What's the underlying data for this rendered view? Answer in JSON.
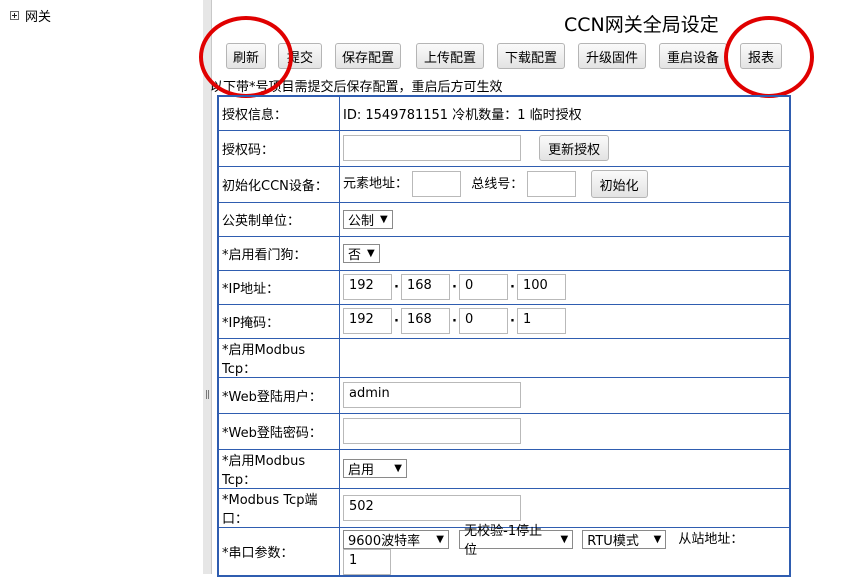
{
  "sidebar": {
    "tree_label": "网关"
  },
  "page_title": "CCN网关全局设定",
  "toolbar": {
    "refresh": "刷新",
    "submit": "提交",
    "save_config": "保存配置",
    "upload_config": "上传配置",
    "download_config": "下载配置",
    "upgrade_firmware": "升级固件",
    "reboot": "重启设备",
    "report": "报表"
  },
  "note": "以下带*号项目需提交后保存配置，重启后方可生效",
  "rows": {
    "license_info": {
      "label": "授权信息：",
      "value": "ID: 1549781151 冷机数量：1 临时授权"
    },
    "license_code": {
      "label": "授权码：",
      "value": "",
      "button": "更新授权"
    },
    "init_ccn": {
      "label": "初始化CCN设备：",
      "element_addr_label": "元素地址：",
      "element_addr": "",
      "bus_no_label": "总线号：",
      "bus_no": "",
      "button": "初始化"
    },
    "unit": {
      "label": "公英制单位：",
      "selected": "公制"
    },
    "watchdog": {
      "label": "*启用看门狗：",
      "selected": "否"
    },
    "ip": {
      "label": "*IP地址：",
      "octets": [
        "192",
        "168",
        "0",
        "100"
      ]
    },
    "mask": {
      "label": "*IP掩码：",
      "octets": [
        "192",
        "168",
        "0",
        "1"
      ]
    },
    "modbus_tcp_a": {
      "label": "*启用Modbus Tcp："
    },
    "web_user": {
      "label": "*Web登陆用户：",
      "value": "admin"
    },
    "web_pass": {
      "label": "*Web登陆密码：",
      "value": ""
    },
    "modbus_tcp_b": {
      "label": "*启用Modbus Tcp：",
      "selected": "启用"
    },
    "modbus_port": {
      "label": "*Modbus Tcp端口：",
      "value": "502"
    },
    "serial": {
      "label": "*串口参数：",
      "baud": "9600波特率",
      "parity": "无校验-1停止位",
      "mode": "RTU模式",
      "slave_label": "从站地址：",
      "slave": "1"
    }
  },
  "colors": {
    "table_border": "#2f5db0",
    "annotation": "#e00000"
  }
}
